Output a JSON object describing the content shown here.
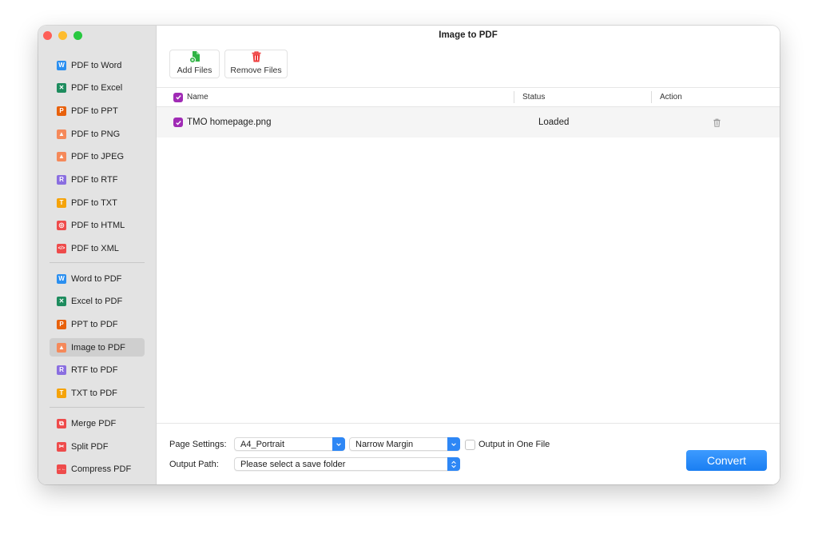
{
  "window": {
    "title": "Image to PDF"
  },
  "sidebar": {
    "groups": [
      [
        {
          "label": "PDF to Word",
          "icon": "word-icon",
          "glyph": "W",
          "color": "#2b8ff0"
        },
        {
          "label": "PDF to Excel",
          "icon": "excel-icon",
          "glyph": "✕",
          "color": "#1e8c5e"
        },
        {
          "label": "PDF to PPT",
          "icon": "ppt-icon",
          "glyph": "P",
          "color": "#e8610c"
        },
        {
          "label": "PDF to PNG",
          "icon": "image-icon",
          "glyph": "▲",
          "color": "#f5895a"
        },
        {
          "label": "PDF to JPEG",
          "icon": "image-icon",
          "glyph": "▲",
          "color": "#f5895a"
        },
        {
          "label": "PDF to RTF",
          "icon": "rtf-icon",
          "glyph": "R",
          "color": "#8a6ee0"
        },
        {
          "label": "PDF to TXT",
          "icon": "txt-icon",
          "glyph": "T",
          "color": "#f5a30a"
        },
        {
          "label": "PDF to HTML",
          "icon": "html-icon",
          "glyph": "◎",
          "color": "#ee4b4b"
        },
        {
          "label": "PDF to XML",
          "icon": "xml-icon",
          "glyph": "</>",
          "color": "#ee4b4b"
        }
      ],
      [
        {
          "label": "Word to PDF",
          "icon": "word-icon",
          "glyph": "W",
          "color": "#2b8ff0"
        },
        {
          "label": "Excel to PDF",
          "icon": "excel-icon",
          "glyph": "✕",
          "color": "#1e8c5e"
        },
        {
          "label": "PPT to PDF",
          "icon": "ppt-icon",
          "glyph": "P",
          "color": "#e8610c"
        },
        {
          "label": "Image to PDF",
          "icon": "image-icon",
          "glyph": "▲",
          "color": "#f5895a",
          "active": true
        },
        {
          "label": "RTF to PDF",
          "icon": "rtf-icon",
          "glyph": "R",
          "color": "#8a6ee0"
        },
        {
          "label": "TXT to PDF",
          "icon": "txt-icon",
          "glyph": "T",
          "color": "#f5a30a"
        }
      ],
      [
        {
          "label": "Merge PDF",
          "icon": "merge-icon",
          "glyph": "⧉",
          "color": "#ee4b4b"
        },
        {
          "label": "Split PDF",
          "icon": "scissors-icon",
          "glyph": "✂",
          "color": "#ee4b4b"
        },
        {
          "label": "Compress PDF",
          "icon": "compress-icon",
          "glyph": "→←",
          "color": "#ee4b4b"
        }
      ]
    ]
  },
  "toolbar": {
    "add_files_label": "Add Files",
    "remove_files_label": "Remove Files"
  },
  "table": {
    "columns": {
      "name": "Name",
      "status": "Status",
      "action": "Action"
    },
    "rows": [
      {
        "name": "TMO homepage.png",
        "status": "Loaded",
        "checked": true
      }
    ]
  },
  "footer": {
    "page_settings_label": "Page Settings:",
    "page_size": "A4_Portrait",
    "margin": "Narrow Margin",
    "output_one_file_label": "Output in One File",
    "output_one_file_checked": false,
    "output_path_label": "Output Path:",
    "output_path_placeholder": "Please select a save folder",
    "convert_label": "Convert"
  },
  "colors": {
    "accent": "#2e87f5",
    "checkbox": "#a02bb5"
  }
}
